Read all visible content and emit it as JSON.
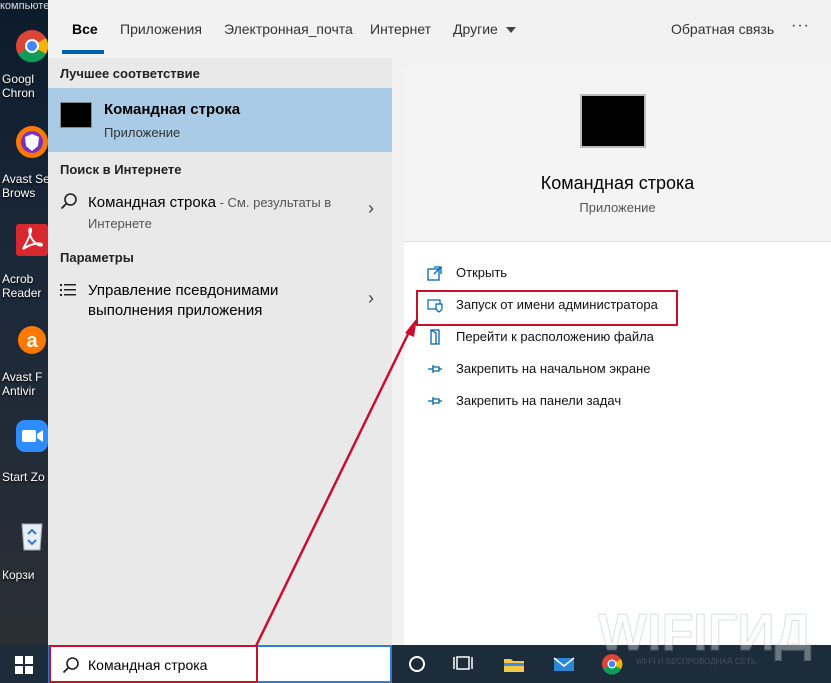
{
  "desktop": {
    "top_text": "компьютер",
    "icons": [
      {
        "label1": "Googl",
        "label2": "Chron"
      },
      {
        "label1": "Avast Se",
        "label2": "Brows"
      },
      {
        "label1": "Acrob",
        "label2": "Reader"
      },
      {
        "label1": "Avast F",
        "label2": "Antivir"
      },
      {
        "label1": "Start Zo",
        "label2": ""
      },
      {
        "label1": "Корзи",
        "label2": ""
      }
    ]
  },
  "tabs": {
    "all": "Все",
    "apps": "Приложения",
    "email": "Электронная_почта",
    "internet": "Интернет",
    "other": "Другие",
    "feedback": "Обратная связь",
    "more": "···"
  },
  "left": {
    "best_match_title": "Лучшее соответствие",
    "best_match": {
      "title": "Командная строка",
      "subtitle": "Приложение"
    },
    "web_title": "Поиск в Интернете",
    "web_item": {
      "title": "Командная строка",
      "suffix": " - См. результаты в",
      "line2": "Интернете"
    },
    "settings_title": "Параметры",
    "settings_item": {
      "line1": "Управление псевдонимами",
      "line2": "выполнения приложения"
    }
  },
  "preview": {
    "title": "Командная строка",
    "subtitle": "Приложение"
  },
  "actions": [
    {
      "label": "Открыть",
      "icon": "open-icon"
    },
    {
      "label": "Запуск от имени администратора",
      "icon": "shield-icon"
    },
    {
      "label": "Перейти к расположению файла",
      "icon": "file-location-icon"
    },
    {
      "label": "Закрепить на начальном экране",
      "icon": "pin-icon"
    },
    {
      "label": "Закрепить на панели задач",
      "icon": "pin-icon"
    }
  ],
  "search": {
    "value": "Командная строка"
  },
  "watermark": {
    "text": "WIFIГИД",
    "sub": "WI-FI И БЕСПРОВОДНАЯ СЕТЬ"
  },
  "colors": {
    "accent": "#0063b1",
    "highlight": "#a9cbe6",
    "annotation": "#c8102e"
  }
}
